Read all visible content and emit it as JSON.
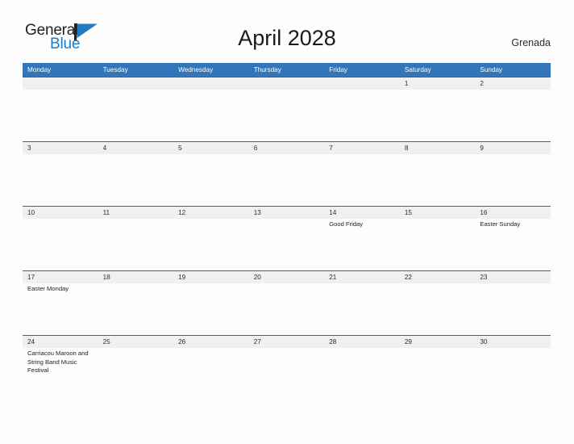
{
  "brand": {
    "word_one": "General",
    "word_two": "Blue",
    "flag_icon": "triangle-flag-icon",
    "accent_color": "#1e7bc4",
    "text_color": "#231f20"
  },
  "header": {
    "title": "April 2028",
    "region": "Grenada"
  },
  "theme": {
    "header_blue": "#3275b8",
    "separator_blue": "#1f6cb0",
    "date_band_gray": "#f0f0f0",
    "page_background": "#fdfdfe"
  },
  "calendar": {
    "month": "April",
    "year": "2028",
    "weekdays": [
      "Monday",
      "Tuesday",
      "Wednesday",
      "Thursday",
      "Friday",
      "Saturday",
      "Sunday"
    ],
    "weeks": [
      {
        "days": [
          {
            "date": "",
            "event": ""
          },
          {
            "date": "",
            "event": ""
          },
          {
            "date": "",
            "event": ""
          },
          {
            "date": "",
            "event": ""
          },
          {
            "date": "",
            "event": ""
          },
          {
            "date": "1",
            "event": ""
          },
          {
            "date": "2",
            "event": ""
          }
        ]
      },
      {
        "days": [
          {
            "date": "3",
            "event": ""
          },
          {
            "date": "4",
            "event": ""
          },
          {
            "date": "5",
            "event": ""
          },
          {
            "date": "6",
            "event": ""
          },
          {
            "date": "7",
            "event": ""
          },
          {
            "date": "8",
            "event": ""
          },
          {
            "date": "9",
            "event": ""
          }
        ]
      },
      {
        "days": [
          {
            "date": "10",
            "event": ""
          },
          {
            "date": "11",
            "event": ""
          },
          {
            "date": "12",
            "event": ""
          },
          {
            "date": "13",
            "event": ""
          },
          {
            "date": "14",
            "event": "Good Friday"
          },
          {
            "date": "15",
            "event": ""
          },
          {
            "date": "16",
            "event": "Easter Sunday"
          }
        ]
      },
      {
        "days": [
          {
            "date": "17",
            "event": "Easter Monday"
          },
          {
            "date": "18",
            "event": ""
          },
          {
            "date": "19",
            "event": ""
          },
          {
            "date": "20",
            "event": ""
          },
          {
            "date": "21",
            "event": ""
          },
          {
            "date": "22",
            "event": ""
          },
          {
            "date": "23",
            "event": ""
          }
        ]
      },
      {
        "days": [
          {
            "date": "24",
            "event": "Carriacou Maroon and String Band Music Festival"
          },
          {
            "date": "25",
            "event": ""
          },
          {
            "date": "26",
            "event": ""
          },
          {
            "date": "27",
            "event": ""
          },
          {
            "date": "28",
            "event": ""
          },
          {
            "date": "29",
            "event": ""
          },
          {
            "date": "30",
            "event": ""
          }
        ]
      }
    ]
  }
}
